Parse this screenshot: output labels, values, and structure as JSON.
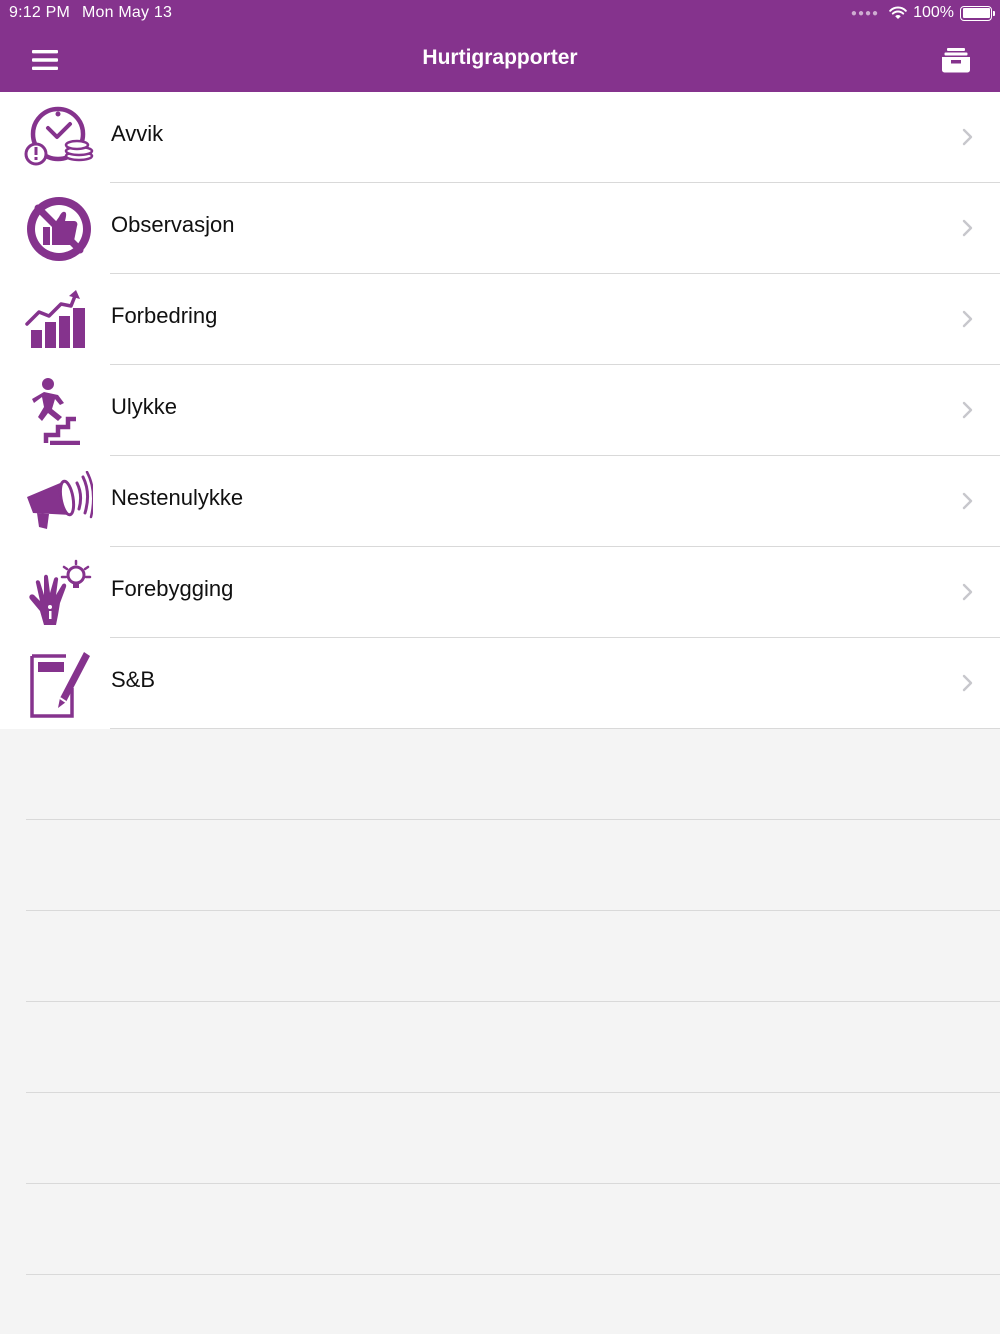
{
  "status_bar": {
    "time": "9:12 PM",
    "date": "Mon May 13",
    "battery": "100%",
    "signal_icon": "cellular-dots-icon",
    "wifi_icon": "wifi-icon",
    "battery_icon": "battery-full-icon"
  },
  "nav": {
    "title": "Hurtigrapporter",
    "menu_icon": "hamburger-menu-icon",
    "right_icon": "inbox-tray-icon"
  },
  "colors": {
    "brand": "#85338d",
    "background": "#f4f4f4",
    "separator": "#d9d9d9",
    "chevron": "#c7c7cc"
  },
  "reports": [
    {
      "label": "Avvik",
      "icon": "clock-coins-warning-icon"
    },
    {
      "label": "Observasjon",
      "icon": "no-thumbs-up-icon"
    },
    {
      "label": "Forbedring",
      "icon": "rising-bar-chart-icon"
    },
    {
      "label": "Ulykke",
      "icon": "person-falling-stairs-icon"
    },
    {
      "label": "Nestenulykke",
      "icon": "megaphone-icon"
    },
    {
      "label": "Forebygging",
      "icon": "hand-lightbulb-icon"
    },
    {
      "label": "S&B",
      "icon": "document-pencil-icon"
    }
  ]
}
